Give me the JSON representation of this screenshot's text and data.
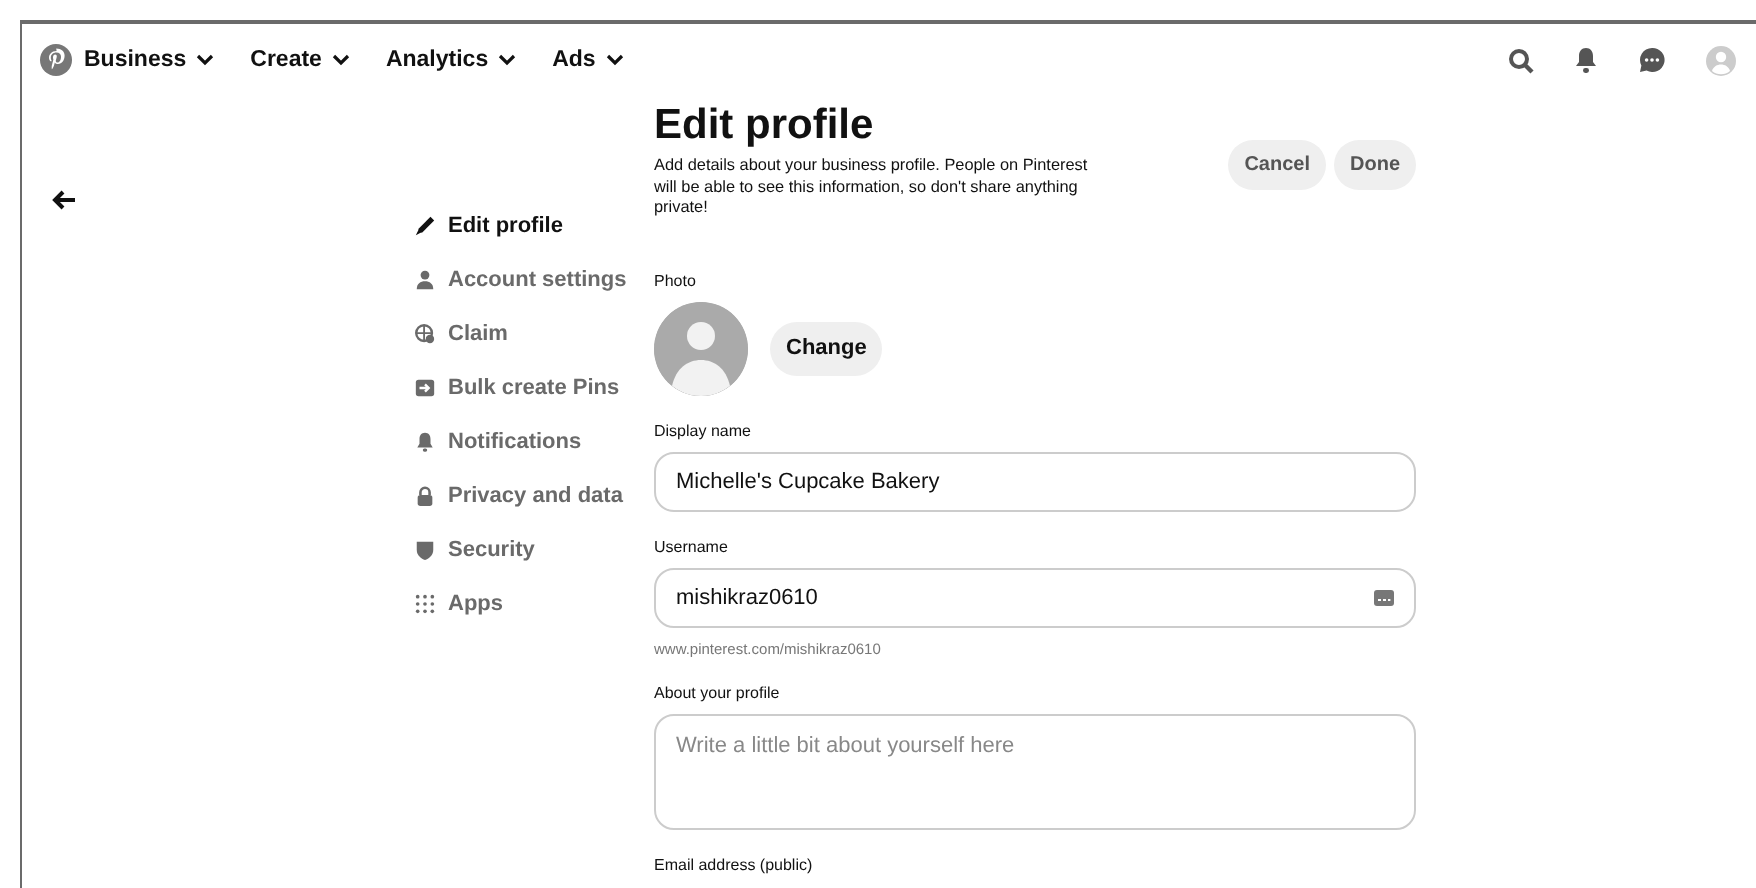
{
  "nav": {
    "items": [
      {
        "label": "Business",
        "kind": "brand"
      },
      {
        "label": "Create",
        "kind": "menu"
      },
      {
        "label": "Analytics",
        "kind": "menu"
      },
      {
        "label": "Ads",
        "kind": "menu"
      }
    ]
  },
  "sidebar": {
    "items": [
      {
        "label": "Edit profile",
        "selected": true
      },
      {
        "label": "Account settings",
        "selected": false
      },
      {
        "label": "Claim",
        "selected": false
      },
      {
        "label": "Bulk create Pins",
        "selected": false
      },
      {
        "label": "Notifications",
        "selected": false
      },
      {
        "label": "Privacy and data",
        "selected": false
      },
      {
        "label": "Security",
        "selected": false
      },
      {
        "label": "Apps",
        "selected": false
      }
    ]
  },
  "header": {
    "title": "Edit profile",
    "description": "Add details about your business profile. People on Pinterest will be able to see this information, so don't share anything private!",
    "buttons": [
      "Cancel",
      "Done"
    ]
  },
  "photo": {
    "label": "Photo",
    "button": "Change"
  },
  "fields": [
    {
      "kind": "text",
      "label": "Display name",
      "value": "Michelle's Cupcake Bakery"
    },
    {
      "kind": "username",
      "label": "Username",
      "value": "mishikraz0610",
      "hint": "www.pinterest.com/mishikraz0610"
    },
    {
      "kind": "textarea",
      "label": "About your profile",
      "placeholder": "Write a little bit about yourself here"
    },
    {
      "kind": "label",
      "label": "Email address (public)"
    }
  ]
}
